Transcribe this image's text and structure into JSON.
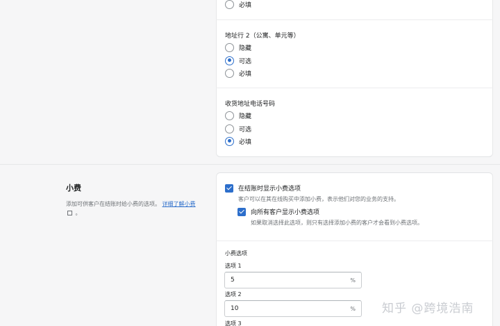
{
  "checkout_fields": {
    "top_option": {
      "label": "必填",
      "selected": false
    },
    "address_line2": {
      "title": "地址行 2（公寓、单元等）",
      "options": [
        {
          "label": "隐藏",
          "selected": false
        },
        {
          "label": "可选",
          "selected": true
        },
        {
          "label": "必填",
          "selected": false
        }
      ]
    },
    "shipping_phone": {
      "title": "收货地址电话号码",
      "options": [
        {
          "label": "隐藏",
          "selected": false
        },
        {
          "label": "可选",
          "selected": false
        },
        {
          "label": "必填",
          "selected": true
        }
      ]
    }
  },
  "tipping": {
    "title": "小费",
    "description": "添加可供客户在结账时给小费的选项。",
    "learn_more": "详细了解小费",
    "description_end": "。",
    "show_tips": {
      "label": "在结账时显示小费选项",
      "checked": true,
      "help": "客户可以在其在线购买中添加小费，表示他们对您的业务的支持。"
    },
    "show_all": {
      "label": "向所有客户显示小费选项",
      "checked": true,
      "help": "如果取消选择此选项，则只有选择添加小费的客户才会看到小费选项。"
    },
    "options_heading": "小费选项",
    "options": [
      {
        "label": "选项 1",
        "value": "5",
        "suffix": "%"
      },
      {
        "label": "选项 2",
        "value": "10",
        "suffix": "%"
      },
      {
        "label": "选项 3"
      }
    ]
  },
  "watermark": "知乎 @跨境浩南"
}
